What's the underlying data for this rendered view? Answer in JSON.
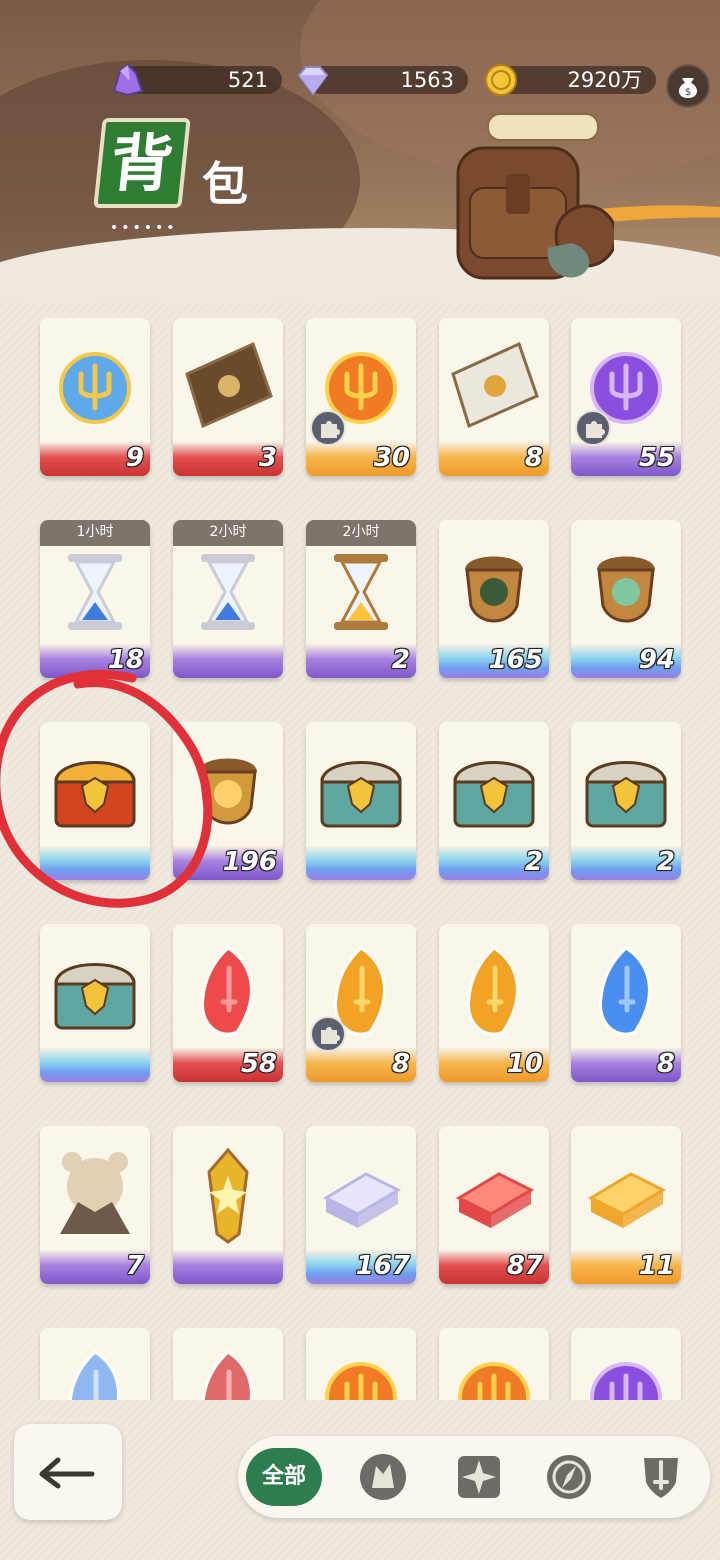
{
  "header": {
    "title_main": "背",
    "title_sub": "包",
    "title_dots": "••••••",
    "currencies": [
      {
        "name": "purple-crystal",
        "value": "521"
      },
      {
        "name": "diamond",
        "value": "1563"
      },
      {
        "name": "gold-coin",
        "value": "2920万"
      }
    ]
  },
  "items": [
    {
      "name": "blue-winged-orb",
      "count": "9",
      "band": "red"
    },
    {
      "name": "treasure-map-scroll",
      "count": "3",
      "band": "red"
    },
    {
      "name": "fire-trident-orb",
      "count": "30",
      "band": "orange",
      "puzzle": true
    },
    {
      "name": "sealed-letter",
      "count": "8",
      "band": "orange"
    },
    {
      "name": "purple-trident-orb",
      "count": "55",
      "band": "purple",
      "puzzle": true
    },
    {
      "name": "silver-hourglass",
      "count": "18",
      "band": "purple",
      "timer": "1小时"
    },
    {
      "name": "silver-hourglass-blue",
      "count": "",
      "band": "purple",
      "timer": "2小时"
    },
    {
      "name": "gold-hourglass",
      "count": "2",
      "band": "purple",
      "timer": "2小时"
    },
    {
      "name": "acorn-eye",
      "count": "165",
      "band": "blue"
    },
    {
      "name": "acorn-leaf",
      "count": "94",
      "band": "blue"
    },
    {
      "name": "red-gold-chest",
      "count": "",
      "band": "blue"
    },
    {
      "name": "golden-acorn",
      "count": "196",
      "band": "purple"
    },
    {
      "name": "teal-shield-chest",
      "count": "",
      "band": "blue"
    },
    {
      "name": "teal-shield-chest",
      "count": "2",
      "band": "blue"
    },
    {
      "name": "teal-shield-chest",
      "count": "2",
      "band": "blue"
    },
    {
      "name": "teal-shield-chest",
      "count": "",
      "band": "blue"
    },
    {
      "name": "red-key-crystal",
      "count": "58",
      "band": "red"
    },
    {
      "name": "gold-key-crystal",
      "count": "8",
      "band": "orange",
      "puzzle": true
    },
    {
      "name": "gold-key-crystal",
      "count": "10",
      "band": "orange"
    },
    {
      "name": "blue-key-crystal",
      "count": "8",
      "band": "purple"
    },
    {
      "name": "hamster-plush",
      "count": "7",
      "band": "purple"
    },
    {
      "name": "golden-amulet",
      "count": "",
      "band": "purple"
    },
    {
      "name": "silver-ingot",
      "count": "167",
      "band": "blue"
    },
    {
      "name": "red-ingot",
      "count": "87",
      "band": "red"
    },
    {
      "name": "gold-ingot",
      "count": "11",
      "band": "orange"
    },
    {
      "name": "blue-crystal-partial",
      "count": "",
      "band": "blue"
    },
    {
      "name": "red-crystal-partial",
      "count": "",
      "band": "red"
    },
    {
      "name": "fire-orb-partial",
      "count": "",
      "band": "orange"
    },
    {
      "name": "fire-orb-partial-2",
      "count": "",
      "band": "orange"
    },
    {
      "name": "purple-orb-partial",
      "count": "",
      "band": "purple"
    }
  ],
  "tabs": {
    "all_label": "全部",
    "icons": [
      "wolf-head-icon",
      "compass-star-icon",
      "compass-needle-icon",
      "sword-shield-icon"
    ]
  },
  "colors": {
    "accent_green": "#2e7d4f",
    "header_brown": "#7a5a47",
    "annotation_red": "#e0303a"
  }
}
